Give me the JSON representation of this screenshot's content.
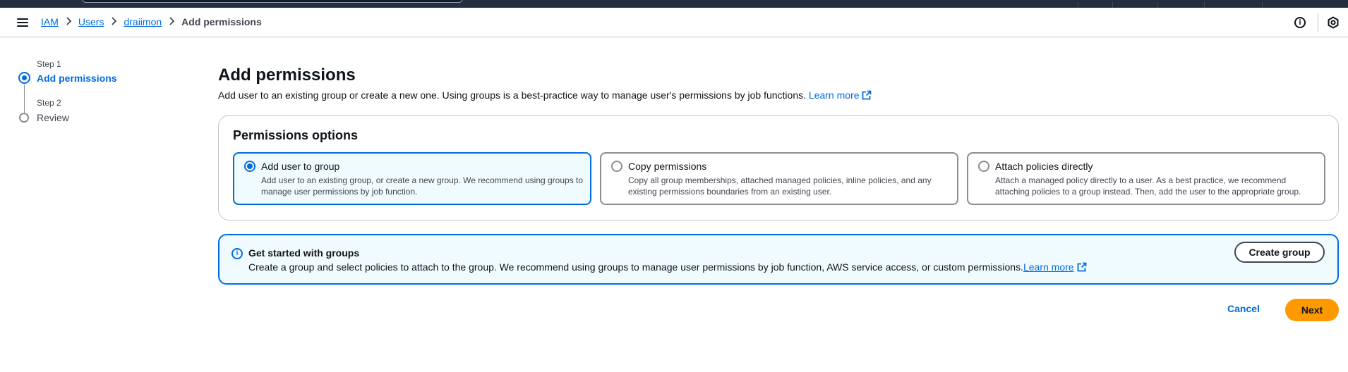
{
  "breadcrumb": {
    "items": [
      "IAM",
      "Users",
      "draiimon"
    ],
    "current": "Add permissions"
  },
  "header": {
    "info_icon": "info-circle-icon",
    "settings_icon": "settings-hexagon-icon"
  },
  "steps": [
    {
      "label": "Step 1",
      "title": "Add permissions",
      "active": true
    },
    {
      "label": "Step 2",
      "title": "Review",
      "active": false
    }
  ],
  "main": {
    "title": "Add permissions",
    "description": "Add user to an existing group or create a new one. Using groups is a best-practice way to manage user's permissions by job functions.",
    "learn_more": "Learn more"
  },
  "permissions_options": {
    "title": "Permissions options",
    "tiles": [
      {
        "title": "Add user to group",
        "description": "Add user to an existing group, or create a new group. We recommend using groups to manage user permissions by job function.",
        "selected": true
      },
      {
        "title": "Copy permissions",
        "description": "Copy all group memberships, attached managed policies, inline policies, and any existing permissions boundaries from an existing user.",
        "selected": false
      },
      {
        "title": "Attach policies directly",
        "description": "Attach a managed policy directly to a user. As a best practice, we recommend attaching policies to a group instead. Then, add the user to the appropriate group.",
        "selected": false
      }
    ]
  },
  "flash": {
    "title": "Get started with groups",
    "description": "Create a group and select policies to attach to the group. We recommend using groups to manage user permissions by job function, AWS service access, or custom permissions.",
    "learn_more": "Learn more",
    "button": "Create group"
  },
  "actions": {
    "cancel": "Cancel",
    "next": "Next"
  },
  "colors": {
    "accent": "#006ce0",
    "primary_button": "#ff9900",
    "topbar": "#232f3e"
  }
}
